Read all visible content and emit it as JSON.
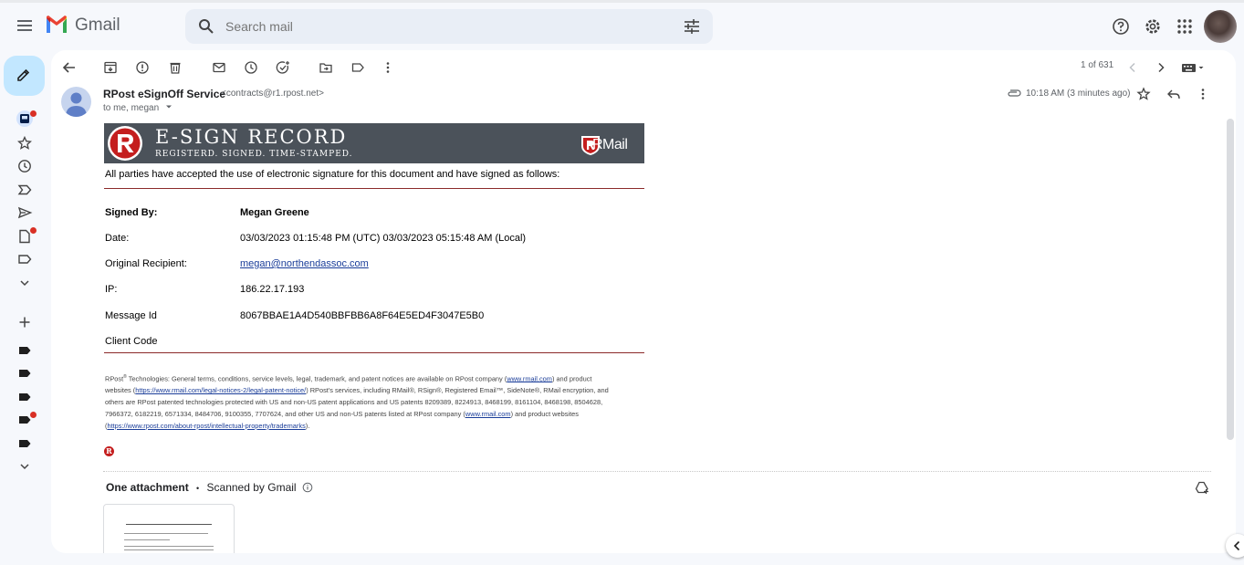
{
  "app": {
    "brand": "Gmail"
  },
  "search": {
    "placeholder": "Search mail"
  },
  "header_icons": [
    "help-icon",
    "settings-icon",
    "apps-icon"
  ],
  "rail": {
    "compose": "compose-pencil-icon",
    "items": [
      "inbox-icon",
      "starred-icon",
      "snoozed-icon",
      "important-icon",
      "sent-icon",
      "drafts-icon",
      "label-icon",
      "more-icon"
    ],
    "labels_add": "plus-icon"
  },
  "toolbar": {
    "icons": [
      "back-icon",
      "archive-icon",
      "spam-icon",
      "delete-icon",
      "mark-unread-icon",
      "snooze-icon",
      "add-task-icon",
      "move-to-icon",
      "label-icon",
      "more-vert-icon"
    ],
    "pager": "1 of 631"
  },
  "email": {
    "sender_name": "RPost eSignOff Service",
    "sender_email": "<contracts@r1.rpost.net>",
    "to": "to me, megan",
    "time": "10:18 AM (3 minutes ago)",
    "banner": {
      "title": "E-SIGN RECORD",
      "subtitle": "REGISTERD. SIGNED. TIME-STAMPED.",
      "brand": "RMail"
    },
    "accepted_text": "All parties have accepted the use of electronic signature for this document and have signed as follows:",
    "fields": [
      {
        "label": "Signed By:",
        "value": "Megan Greene"
      },
      {
        "label": "Date:",
        "value": "03/03/2023 01:15:48 PM (UTC) 03/03/2023 05:15:48 AM (Local)"
      },
      {
        "label": "Original Recipient:",
        "value": "megan@northendassoc.com"
      },
      {
        "label": "IP:",
        "value": "186.22.17.193"
      },
      {
        "label": "Message Id",
        "value": "8067BBAE1A4D540BBFBB6A8F64E5ED4F3047E5B0"
      },
      {
        "label": "Client Code",
        "value": ""
      }
    ],
    "legal": {
      "l1a": "RPost",
      "l1b": " Technologies: General terms, conditions, service levels, legal, trademark, and patent notices are available on RPost company (",
      "link1": "www.rmail.com",
      "l1c": ") and product",
      "l2a": "websites (",
      "link2": "https://www.rmail.com/legal-notices-2/legal-patent-notice/",
      "l2b": ") RPost's services, including RMail®, RSign®, Registered Email™, SideNote®, RMail encryption, and",
      "l3": "others are RPost patented technologies protected with US and non-US patent applications and US patents 8209389, 8224913, 8468199, 8161104, 8468198, 8504628,",
      "l4a": "7966372, 6182219, 6571334, 8484706, 9100355, 7707624, and other US and non-US patents listed at RPost company (",
      "link3": "www.rmail.com",
      "l4b": ") and product websites",
      "l5a": "(",
      "link4": "https://www.rpost.com/about-rpost/intellectual-property/trademarks",
      "l5b": ")."
    },
    "attachment": {
      "count_label": "One attachment",
      "sep": "•",
      "scan_label": "Scanned by Gmail"
    }
  }
}
